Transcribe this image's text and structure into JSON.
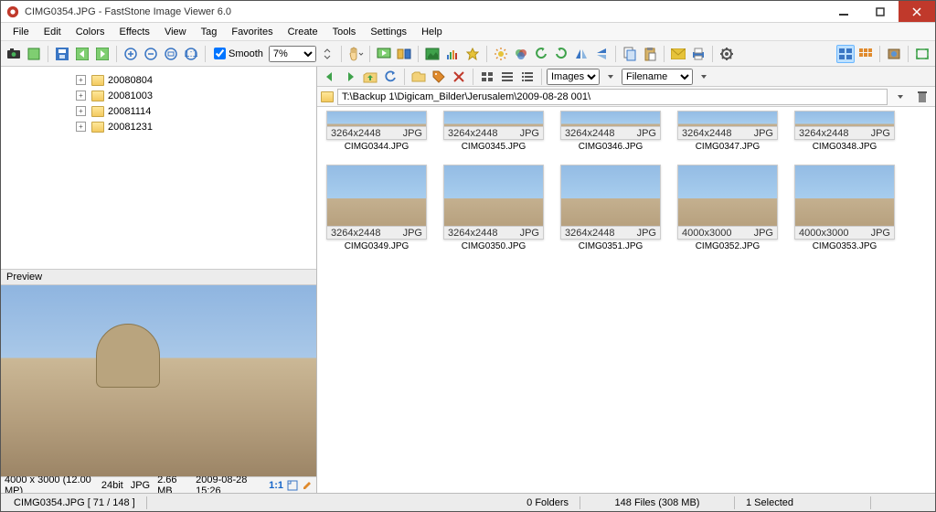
{
  "window": {
    "title": "CIMG0354.JPG  -  FastStone Image Viewer 6.0"
  },
  "menu": [
    "File",
    "Edit",
    "Colors",
    "Effects",
    "View",
    "Tag",
    "Favorites",
    "Create",
    "Tools",
    "Settings",
    "Help"
  ],
  "toolbar": {
    "smooth_label": "Smooth",
    "zoom": "7%",
    "zoom_options": [
      "7%"
    ]
  },
  "right_toolbar": {
    "view_select": "Images",
    "sort_select": "Filename"
  },
  "path": "T:\\Backup 1\\Digicam_Bilder\\Jerusalem\\2009-08-28 001\\",
  "tree": [
    {
      "label": "20080804"
    },
    {
      "label": "20081003"
    },
    {
      "label": "20081114"
    },
    {
      "label": "20081231"
    }
  ],
  "preview": {
    "header": "Preview",
    "info": {
      "dims": "4000 x 3000 (12.00 MP)",
      "depth": "24bit",
      "type": "JPG",
      "size": "2.66 MB",
      "date": "2009-08-28 15:26",
      "one_to_one": "1:1"
    }
  },
  "thumbs_partial": [
    {
      "name": "CIMG0344.JPG",
      "dims": "3264x2448",
      "ext": "JPG"
    },
    {
      "name": "CIMG0345.JPG",
      "dims": "3264x2448",
      "ext": "JPG"
    },
    {
      "name": "CIMG0346.JPG",
      "dims": "3264x2448",
      "ext": "JPG"
    },
    {
      "name": "CIMG0347.JPG",
      "dims": "3264x2448",
      "ext": "JPG"
    },
    {
      "name": "CIMG0348.JPG",
      "dims": "3264x2448",
      "ext": "JPG"
    }
  ],
  "thumbs_full": [
    {
      "name": "CIMG0349.JPG",
      "dims": "3264x2448",
      "ext": "JPG"
    },
    {
      "name": "CIMG0350.JPG",
      "dims": "3264x2448",
      "ext": "JPG"
    },
    {
      "name": "CIMG0351.JPG",
      "dims": "3264x2448",
      "ext": "JPG"
    },
    {
      "name": "CIMG0352.JPG",
      "dims": "4000x3000",
      "ext": "JPG"
    },
    {
      "name": "CIMG0353.JPG",
      "dims": "4000x3000",
      "ext": "JPG"
    }
  ],
  "status": {
    "left": "CIMG0354.JPG [ 71 / 148 ]",
    "folders": "0 Folders",
    "files": "148 Files (308 MB)",
    "selected": "1 Selected"
  },
  "colors": {
    "blue": "#3a76c4",
    "green": "#3fa24b",
    "red": "#c0392b",
    "orange": "#e08a2c",
    "yellow": "#e6c33a",
    "teal": "#2fa59a",
    "purple": "#7a52b5",
    "dark": "#555"
  }
}
